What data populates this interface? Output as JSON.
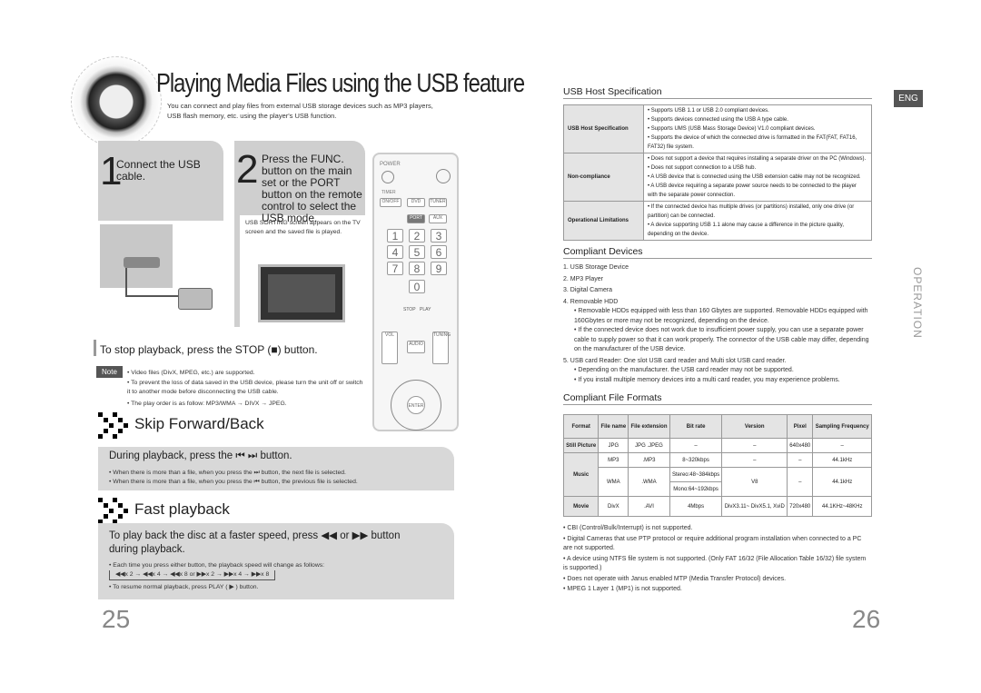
{
  "left_page": {
    "title": "Playing Media Files using the USB  feature",
    "intro": "You can connect and play files from external USB storage devices such as  MP3 players, USB flash memory, etc. using the player's USB  function.",
    "step1": {
      "number": "1",
      "text": "Connect the USB cable."
    },
    "step2": {
      "number": "2",
      "text": "Press the FUNC. button on the main set or the PORT button on the remote control to select the USB mode.",
      "bullet": "USB SORTING screen appears on the TV screen and the saved file is played."
    },
    "remote": {
      "power": "POWER",
      "timer": "TIMER",
      "onoff": "ON/OFF",
      "dvd": "DVD",
      "tuner": "TUNER",
      "port": "PORT",
      "aux": "AUX",
      "digits": [
        "1",
        "2",
        "3",
        "4",
        "5",
        "6",
        "7",
        "8",
        "9",
        "0"
      ],
      "stop": "STOP",
      "play": "PLAY",
      "vol": "VOL",
      "audio": "AUDIO",
      "tuning": "TUNING",
      "enter": "ENTER"
    },
    "stop_text": "To stop playback, press the STOP (■) button.",
    "note": {
      "label": "Note",
      "items": [
        "Video files (DivX,  MPEG, etc.) are  supported.",
        "To prevent the loss of data saved in the USB device, please turn the unit off or switch it to another mode before disconnecting the USB cable.",
        "The play order is as follow: MP3/WMA → DIVX → JPEG."
      ]
    },
    "skip": {
      "heading": "Skip Forward/Back",
      "instruction": "During playback, press the ⏮ ⏭ button.",
      "items": [
        "When there is more than a file, when you press the ⏭ button, the next file is selected.",
        "When there is more than a file, when you press the ⏮ button, the previous file is selected."
      ]
    },
    "fast": {
      "heading": "Fast playback",
      "instruction": "To play back the disc at a faster speed, press ◀◀ or ▶▶ button during playback.",
      "items": [
        "Each time you press either button, the playback speed will change as follows:",
        "To resume normal playback, press PLAY ( ▶ ) button."
      ],
      "sequence": "◀◀x 2 → ◀◀x 4 → ◀◀x 8  or  ▶▶x 2 → ▶▶x 4 → ▶▶x 8"
    },
    "page_number": "25"
  },
  "right_page": {
    "eng_badge": "ENG",
    "side_tab": "OPERATION",
    "usb_host": {
      "heading": "USB Host Specification",
      "rows": [
        {
          "key": "USB Host Specification",
          "value": "• Supports USB 1.1 or USB 2.0 compliant devices.\n• Supports devices connected using the USB A type cable.\n• Supports UMS (USB Mass Storage Device) V1.0 compliant devices.\n• Supports the device of which the connected drive is formatted in the FAT(FAT, FAT16, FAT32) file system."
        },
        {
          "key": "Non-compliance",
          "value": "• Does not support a device that requires installing a separate driver on the PC (Windows).\n• Does not support connection to a USB hub.\n• A USB device that is connected using the USB extension cable may not be recognized.\n• A USB device requiring a separate power source needs to be connected to the player with the separate power connection."
        },
        {
          "key": "Operational Limitations",
          "value": "• If the connected device has multiple drives (or partitions) installed, only one drive (or partition) can be connected.\n• A device supporting USB 1.1 alone may cause a difference in the picture quality, depending on the device."
        }
      ]
    },
    "devices": {
      "heading": "Compliant Devices",
      "items": [
        "1.  USB Storage Device",
        "2.  MP3 Player",
        "3.  Digital Camera",
        "4.  Removable HDD",
        "5.  USB card Reader: One slot USB card reader and Multi slot USB card reader."
      ],
      "hdd_bullets": [
        "Removable HDDs equipped with less than 160 Gbytes are supported. Removable HDDs equipped with 160Gbytes or more may not be recognized, depending on the device.",
        "If the connected device does not work due to insufficient power supply, you can use a separate power cable to supply power so that it can work properly. The connector of the USB cable may differ, depending on the manufacturer of the USB device."
      ],
      "reader_bullets": [
        "Depending on the manufacturer. the USB card reader may not be supported.",
        "If you install multiple memory devices into a multi card reader, you may experience problems."
      ]
    },
    "formats": {
      "heading": "Compliant File Formats",
      "headers": [
        "Format",
        "File name",
        "File extension",
        "Bit rate",
        "Version",
        "Pixel",
        "Sampling Frequency"
      ],
      "still": [
        "Still Picture",
        "JPG",
        "JPG  .JPEG",
        "–",
        "–",
        "640x480",
        "–"
      ],
      "music_label": "Music",
      "mp3": [
        "MP3",
        ".MP3",
        "8~320kbps",
        "–",
        "–",
        "44.1kHz"
      ],
      "wma": [
        "WMA",
        ".WMA",
        "Stereo:48~384kbps",
        "Mono:64~192kbps",
        "V8",
        "–",
        "44.1kHz"
      ],
      "movie": [
        "Movie",
        "DivX",
        ".AVI",
        "4Mbps",
        "DivX3.11~ DivX5.1, XviD",
        "720x480",
        "44.1KHz~48KHz"
      ]
    },
    "notes": [
      "CBI (Control/Bulk/Interrupt) is not supported.",
      "Digital Cameras that use PTP protocol or require additional program installation when connected to a PC are not supported.",
      "A device using NTFS file system is not supported. (Only FAT 16/32 (File Allocation Table 16/32) file system is supported.)",
      "Does not operate with Janus enabled MTP (Media Transfer Protocol) devices.",
      "MPEG 1 Layer 1 (MP1) is not supported."
    ],
    "page_number": "26"
  }
}
